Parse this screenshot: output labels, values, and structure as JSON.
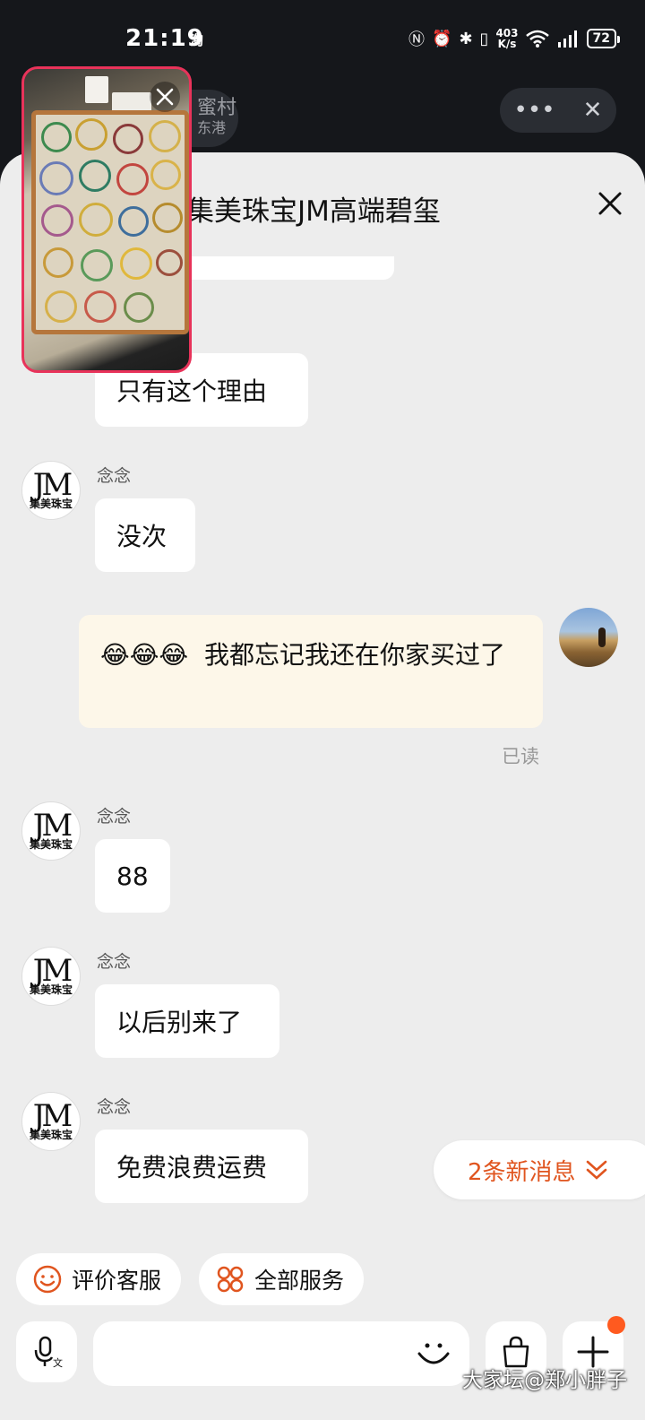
{
  "status_bar": {
    "time": "21:19",
    "app_indicator": "淘",
    "net_speed_value": "403",
    "net_speed_unit": "K/s",
    "battery": "72"
  },
  "live_header": {
    "name": "蜜村",
    "subtitle": "东港"
  },
  "sheet": {
    "title": "集美珠宝JM高端碧玺"
  },
  "shop_avatar": {
    "logo": "JM",
    "text": "集美珠宝"
  },
  "messages": [
    {
      "sender": "",
      "text": "只有这个理由"
    },
    {
      "sender": "念念",
      "text": "没次"
    },
    {
      "sender": "me",
      "emoji": "😂😂😂",
      "text": "我都忘记我还在你家买过了"
    },
    {
      "sender": "念念",
      "text": "88"
    },
    {
      "sender": "念念",
      "text": "以后别来了"
    },
    {
      "sender": "念念",
      "text": "免费浪费运费"
    }
  ],
  "read_status": "已读",
  "new_messages": "2条新消息",
  "service_buttons": [
    {
      "label": "评价客服",
      "icon": "smile-icon"
    },
    {
      "label": "全部服务",
      "icon": "grid-icon"
    }
  ],
  "input": {
    "placeholder": ""
  },
  "watermark": "大家坛@郑小胖子",
  "colors": {
    "accent": "#e0551f",
    "sheet_bg": "#ededed",
    "outgoing_bubble": "#fdf7e9",
    "pip_border": "#e8335a"
  }
}
